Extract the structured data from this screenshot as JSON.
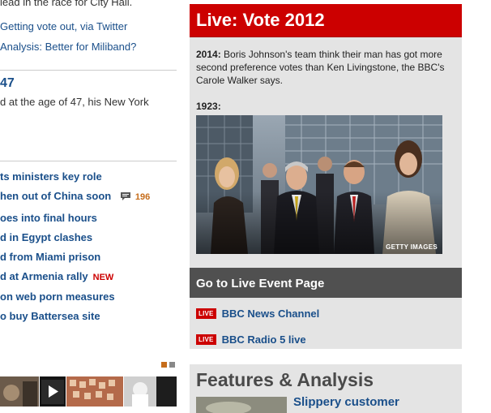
{
  "left": {
    "top_clip": "lead in the race for City Hall.",
    "links_top": [
      "Getting vote out, via Twitter",
      "Analysis: Better for Miliband?"
    ],
    "story": {
      "headline": "47",
      "summary": "d at the age of 47, his New York"
    },
    "headlines": [
      {
        "text": "ts ministers key role"
      },
      {
        "text": "hen out of China soon",
        "comments": "196"
      },
      {
        "text": "oes into final hours"
      },
      {
        "text": "d in Egypt clashes"
      },
      {
        "text": "d from Miami prison"
      },
      {
        "text": "d at Armenia rally",
        "badge": "NEW"
      },
      {
        "text": "on web porn measures"
      },
      {
        "text": "o buy Battersea site"
      }
    ]
  },
  "live": {
    "title": "Live: Vote 2012",
    "entry1_time": "2014:",
    "entry1_text": "Boris Johnson's team think their man has got more second preference votes than Ken Livingstone, the BBC's Carole Walker says.",
    "entry2_time": "1923:",
    "photo_credit": "GETTY IMAGES",
    "goto_label": "Go to Live Event Page",
    "badge_label": "LIVE",
    "channels": [
      "BBC News Channel",
      "BBC Radio 5 live"
    ]
  },
  "features": {
    "title": "Features & Analysis",
    "first_link": "Slippery customer"
  },
  "colors": {
    "accent_red": "#cc0000",
    "link_blue": "#1a4f8a",
    "count_orange": "#c66d1b"
  }
}
